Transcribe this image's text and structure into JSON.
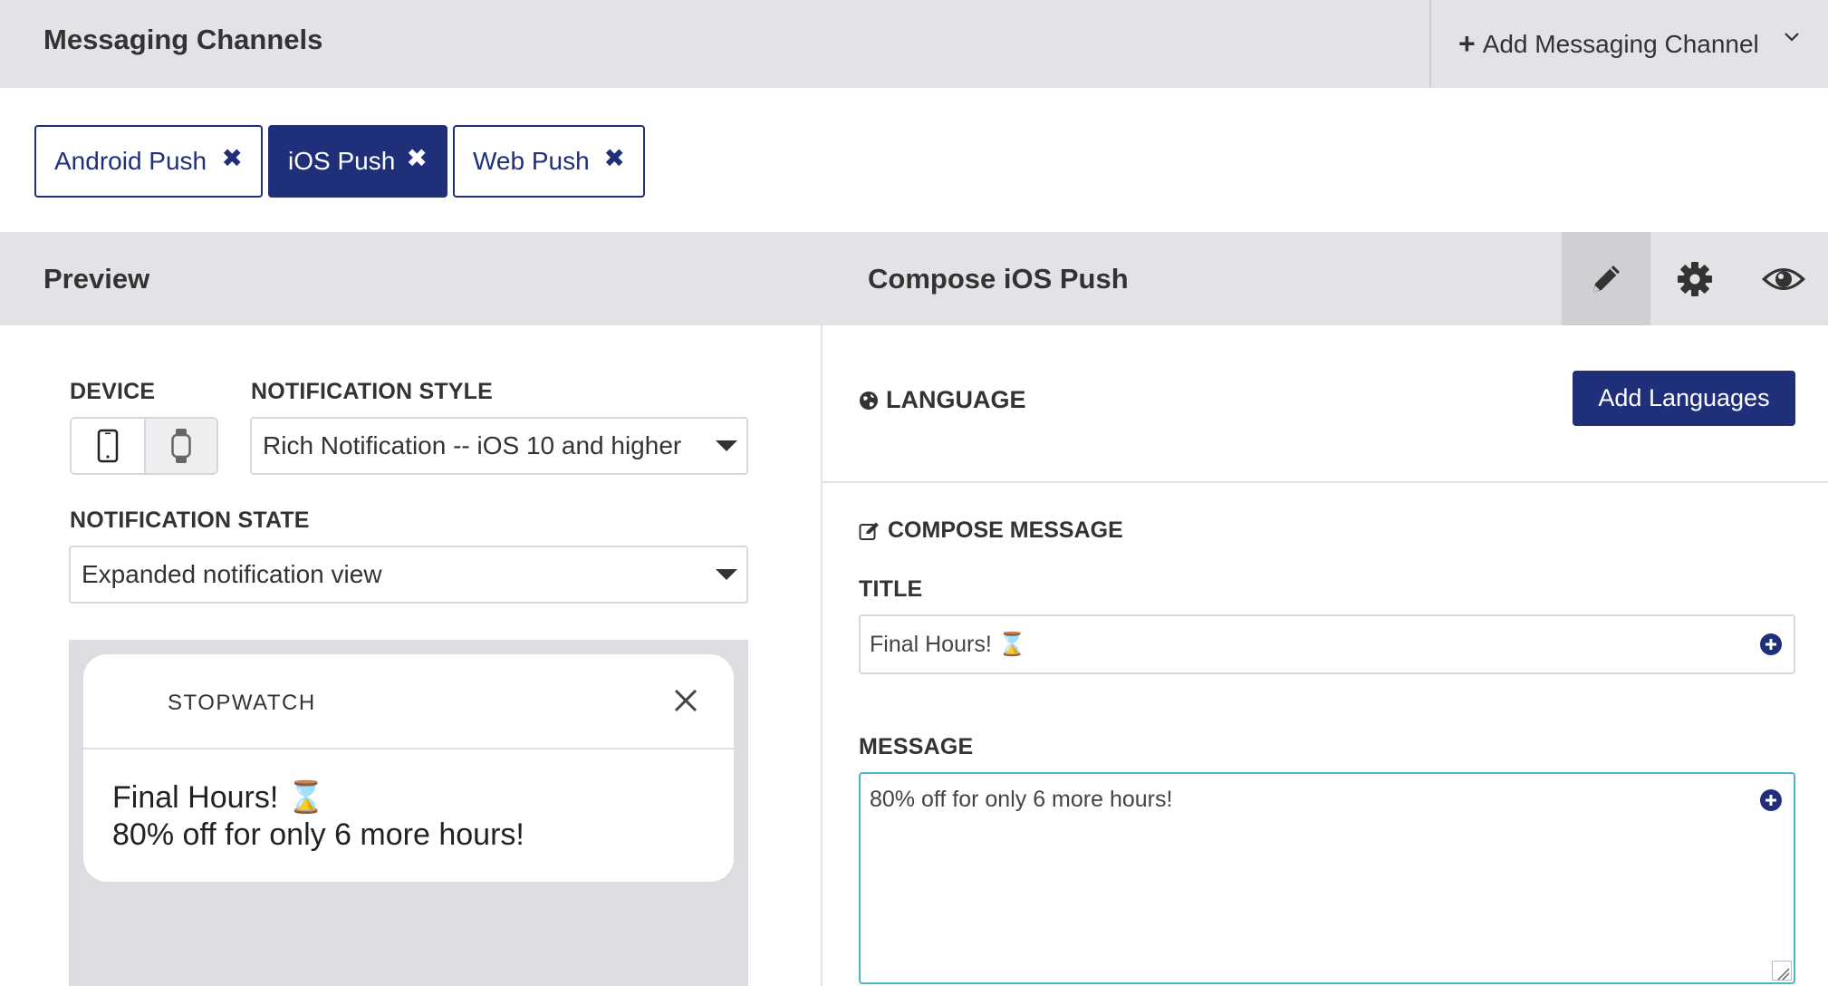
{
  "header": {
    "title": "Messaging Channels",
    "add_channel_label": "Add Messaging Channel"
  },
  "channels": [
    {
      "label": "Android Push",
      "active": false
    },
    {
      "label": "iOS Push",
      "active": true
    },
    {
      "label": "Web Push",
      "active": false
    }
  ],
  "section": {
    "preview_title": "Preview",
    "compose_title": "Compose iOS Push",
    "tools": [
      "pencil-icon",
      "gear-icon",
      "eye-icon"
    ]
  },
  "preview": {
    "device_label": "DEVICE",
    "device_options": [
      "phone-icon",
      "watch-icon"
    ],
    "style_label": "NOTIFICATION STYLE",
    "style_value": "Rich Notification -- iOS 10 and higher",
    "state_label": "NOTIFICATION STATE",
    "state_value": "Expanded notification view",
    "notification": {
      "app_name": "STOPWATCH",
      "title": "Final Hours! ⌛",
      "body": "80% off for only 6 more hours!"
    }
  },
  "compose": {
    "language_label": "LANGUAGE",
    "add_languages_label": "Add Languages",
    "compose_message_label": "COMPOSE MESSAGE",
    "title_label": "TITLE",
    "title_value": "Final Hours! ⌛",
    "message_label": "MESSAGE",
    "message_value": "80% off for only 6 more hours!"
  },
  "colors": {
    "brand": "#1f2f7a",
    "header_bg": "#e2e2e7",
    "focus_border": "#4ab8c6"
  }
}
